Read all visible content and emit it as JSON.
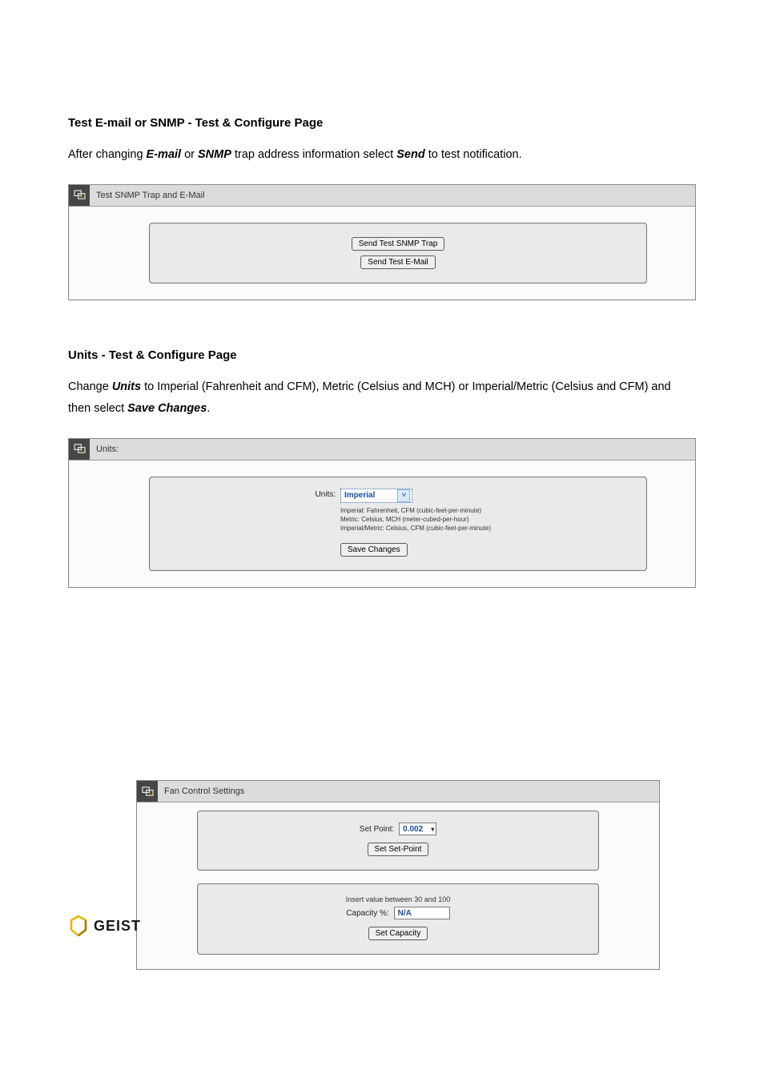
{
  "section1": {
    "title": "Test E-mail or SNMP - Test & Configure Page",
    "intro_prefix": "After changing ",
    "intro_em1": "E-mail",
    "intro_mid": " or ",
    "intro_em2": "SNMP",
    "intro_mid2": " trap address information select ",
    "intro_em3": "Send",
    "intro_suffix": " to test notification.",
    "panel_title": "Test SNMP Trap and E-Mail",
    "btn_snmp": "Send Test SNMP Trap",
    "btn_email": "Send Test E-Mail"
  },
  "section2": {
    "title": "Units - Test & Configure Page",
    "intro_prefix": "Change ",
    "intro_em1": "Units",
    "intro_mid": " to Imperial (Fahrenheit and CFM), Metric (Celsius and MCH) or Imperial/Metric (Celsius and CFM) and then select ",
    "intro_em2": "Save Changes",
    "intro_suffix": ".",
    "panel_title": "Units:",
    "form_label": "Units:",
    "select_value": "Imperial",
    "desc1": "Imperial: Fahrenheit, CFM (cubic-feet-per-minute)",
    "desc2": "Metric: Celsius, MCH (meter-cubed-per-hour)",
    "desc3": "Imperial/Metric: Celsius, CFM (cubic-feet-per-minute)",
    "btn_save": "Save Changes"
  },
  "section3": {
    "panel_title": "Fan Control Settings",
    "setpoint_label": "Set Point:",
    "setpoint_value": "0.002",
    "btn_setpoint": "Set Set-Point",
    "hint": "Insert value between 30 and 100",
    "capacity_label": "Capacity %:",
    "capacity_value": "N/A",
    "btn_capacity": "Set Capacity"
  },
  "logo": {
    "text": "GEIST"
  }
}
